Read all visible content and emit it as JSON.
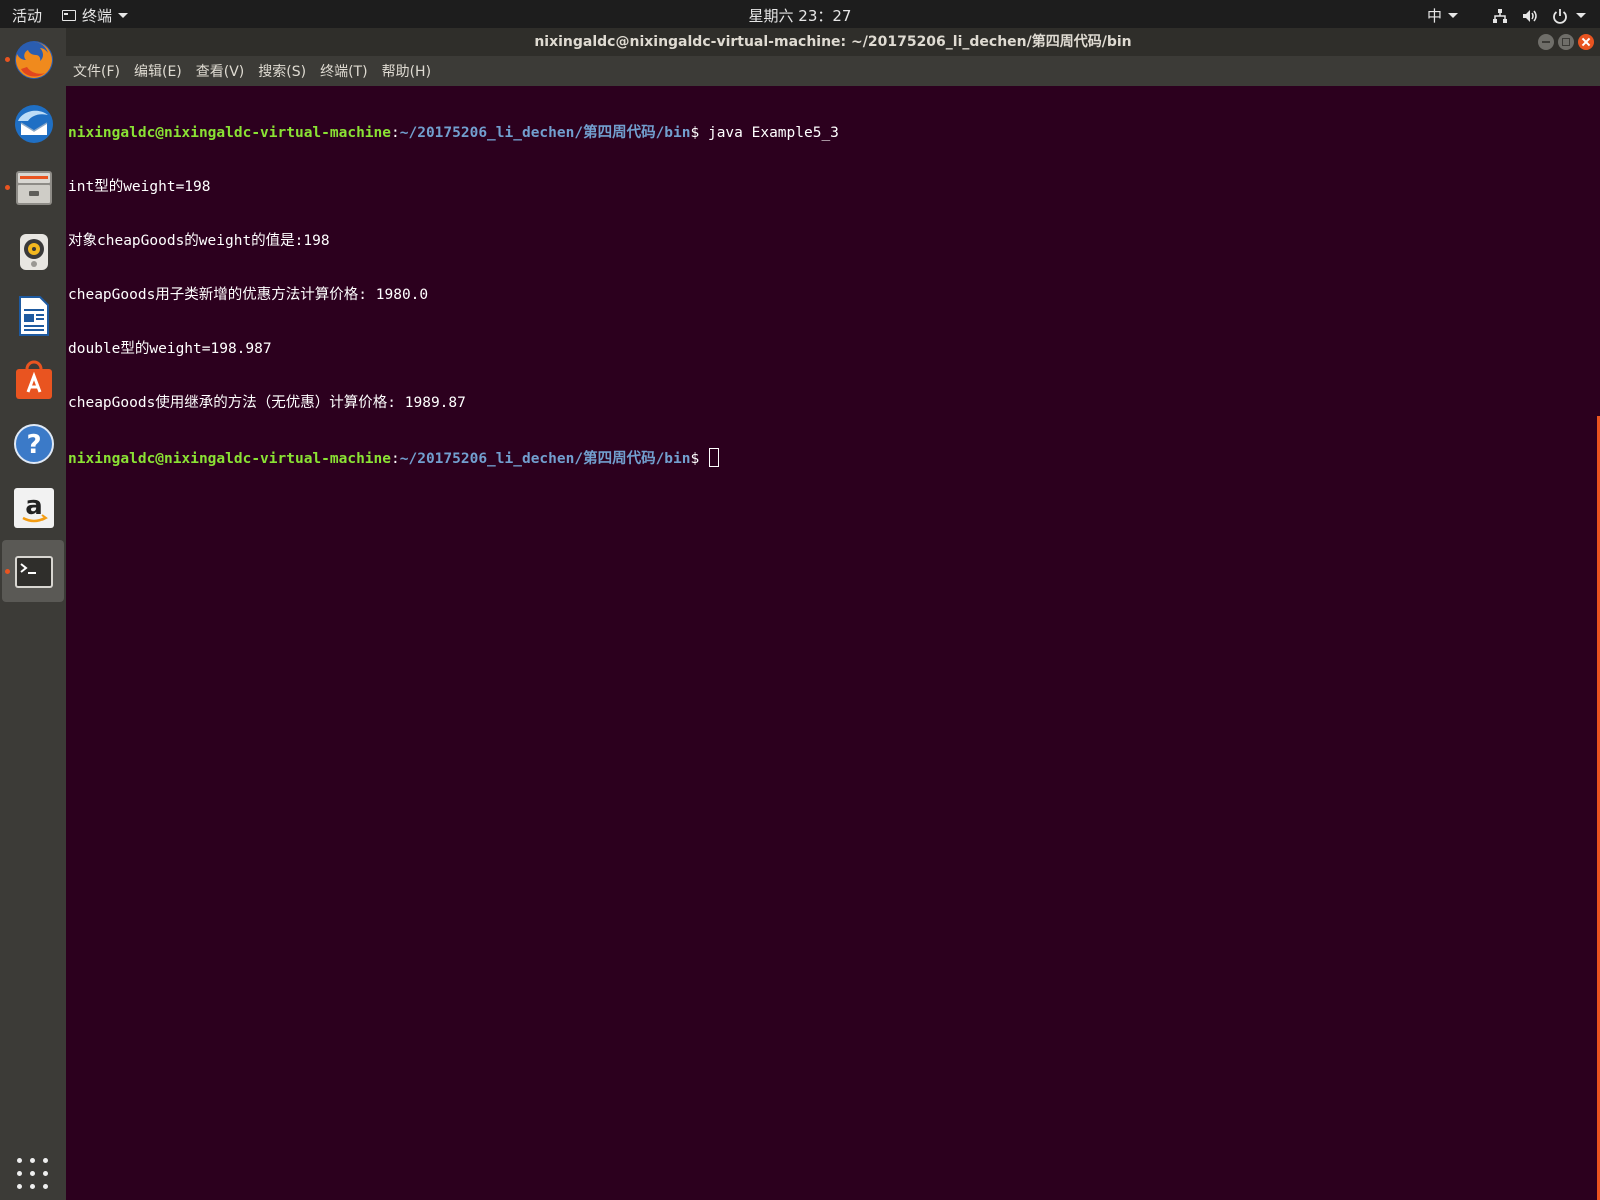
{
  "topbar": {
    "activities": "活动",
    "app_name": "终端",
    "clock": "星期六 23：27",
    "ime": "中"
  },
  "dock": {
    "items": [
      {
        "name": "firefox",
        "icon": "firefox-icon",
        "running": true
      },
      {
        "name": "thunderbird",
        "icon": "thunderbird-icon",
        "running": false
      },
      {
        "name": "files",
        "icon": "files-icon",
        "running": true
      },
      {
        "name": "rhythmbox",
        "icon": "rhythmbox-icon",
        "running": false
      },
      {
        "name": "libreoffice-writer",
        "icon": "writer-icon",
        "running": false
      },
      {
        "name": "software",
        "icon": "software-icon",
        "running": false
      },
      {
        "name": "help",
        "icon": "help-icon",
        "running": false
      },
      {
        "name": "amazon",
        "icon": "amazon-icon",
        "running": false
      },
      {
        "name": "terminal",
        "icon": "terminal-icon",
        "running": true,
        "active": true
      }
    ],
    "help_glyph": "?",
    "amazon_glyph": "a"
  },
  "window": {
    "title": "nixingaldc@nixingaldc-virtual-machine: ~/20175206_li_dechen/第四周代码/bin",
    "menu": [
      "文件(F)",
      "编辑(E)",
      "查看(V)",
      "搜索(S)",
      "终端(T)",
      "帮助(H)"
    ]
  },
  "terminal": {
    "prompt_user": "nixingaldc@nixingaldc-virtual-machine",
    "prompt_colon": ":",
    "prompt_path": "~/20175206_li_dechen/第四周代码/bin",
    "prompt_symbol": "$ ",
    "command": "java Example5_3",
    "output": [
      "int型的weight=198",
      "对象cheapGoods的weight的值是:198",
      "cheapGoods用子类新增的优惠方法计算价格: 1980.0",
      "double型的weight=198.987",
      "cheapGoods使用继承的方法（无优惠）计算价格: 1989.87"
    ]
  },
  "colors": {
    "terminal_bg": "#2c001e",
    "prompt_user": "#8ae234",
    "prompt_path": "#729fcf",
    "accent": "#e95420"
  }
}
